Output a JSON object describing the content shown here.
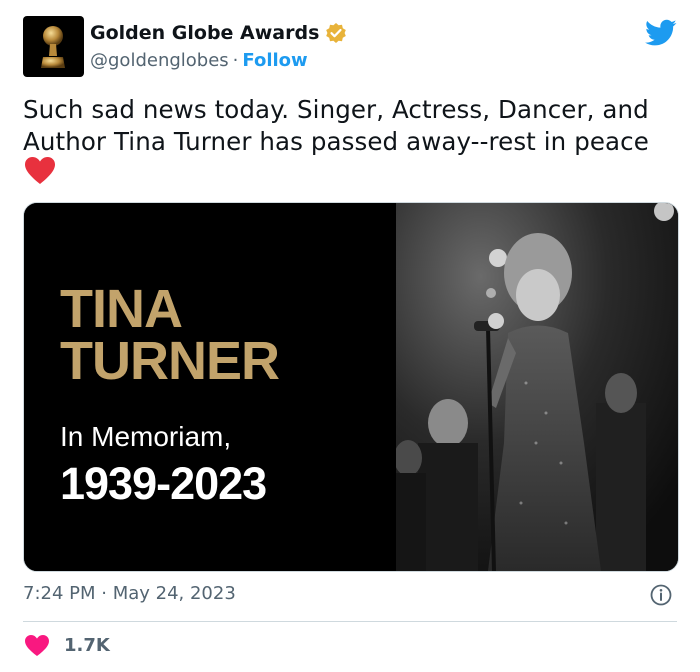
{
  "author": {
    "display_name": "Golden Globe Awards",
    "handle": "@goldenglobes",
    "separator": "·",
    "follow_label": "Follow",
    "avatar_icon": "golden-globe-trophy-icon",
    "verified_icon": "verified-badge-icon"
  },
  "brand": {
    "logo_icon": "twitter-bird-icon",
    "color": "#1d9bf0"
  },
  "tweet": {
    "text": "Such sad news today. Singer, Actress, Dancer, and Author Tina Turner has passed away--rest in peace",
    "emoji": "red-heart"
  },
  "media": {
    "name_line1": "TINA",
    "name_line2": "TURNER",
    "subtitle": "In Memoriam,",
    "years": "1939-2023",
    "gold_color": "#c2a36b"
  },
  "meta": {
    "timestamp": "7:24 PM · May 24, 2023",
    "info_icon": "info-icon"
  },
  "engagement": {
    "likes": "1.7K",
    "like_color": "#f91880"
  }
}
